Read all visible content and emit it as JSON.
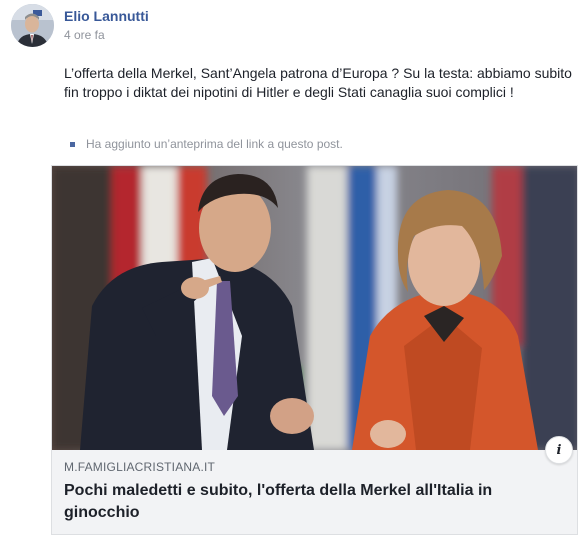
{
  "post": {
    "author": "Elio Lannutti",
    "time": "4 ore fa",
    "text": "L’offerta della Merkel, Sant’Angela patrona d’Europa ? Su la testa: abbiamo subito fin troppo i diktat dei nipotini di Hitler e degli Stati canaglia suoi complici !",
    "notice": "Ha aggiunto un’anteprima del link a questo post."
  },
  "link_preview": {
    "domain": "M.FAMIGLIACRISTIANA.IT",
    "title": "Pochi maledetti e subito, l'offerta della Merkel all'Italia in ginocchio",
    "info_label": "i"
  },
  "colors": {
    "author_link": "#385898",
    "meta_text": "#90949c",
    "card_bg": "#f2f3f5",
    "jacket_orange": "#d4562b"
  },
  "icons": {
    "info": "info-icon",
    "notice_bullet": "square-bullet-icon"
  }
}
